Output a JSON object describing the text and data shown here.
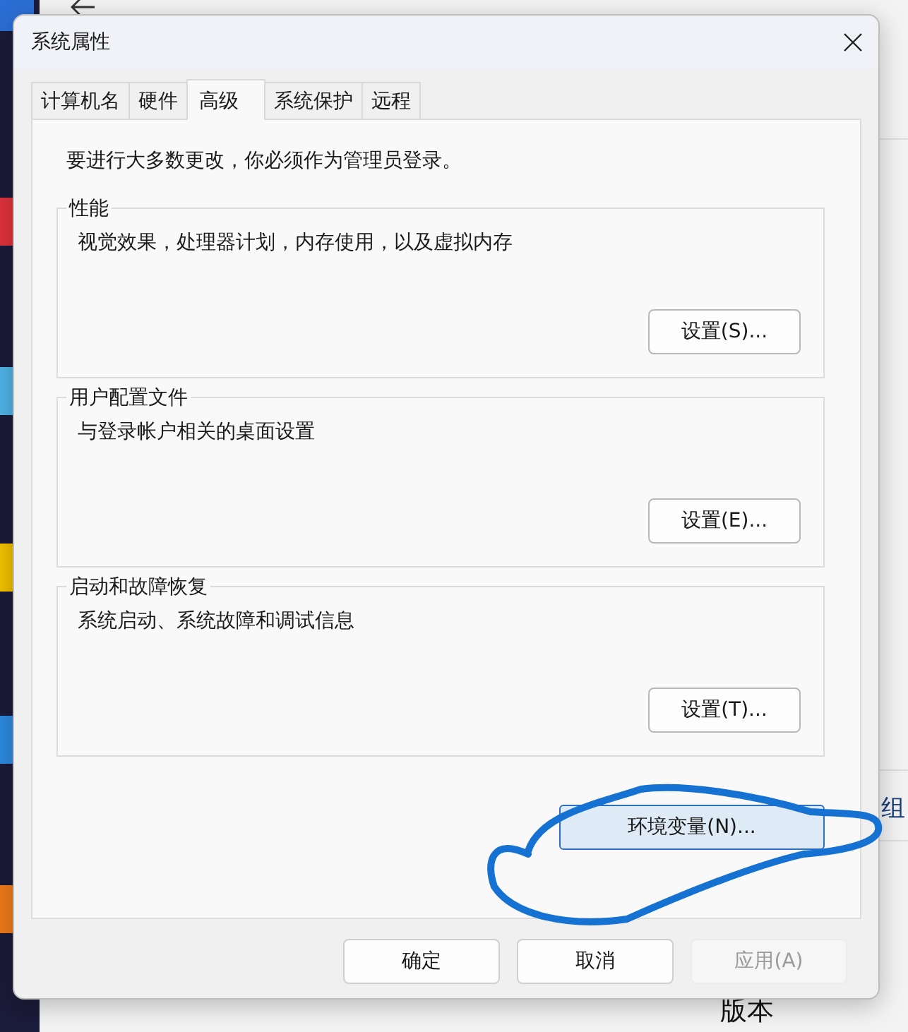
{
  "background": {
    "settings_window": {
      "link": "组",
      "section": "版本"
    }
  },
  "dialog": {
    "title": "系统属性",
    "tabs": [
      {
        "label": "计算机名",
        "selected": false
      },
      {
        "label": "硬件",
        "selected": false
      },
      {
        "label": "高级",
        "selected": true
      },
      {
        "label": "系统保护",
        "selected": false
      },
      {
        "label": "远程",
        "selected": false
      }
    ],
    "notice": "要进行大多数更改，你必须作为管理员登录。",
    "groups": [
      {
        "title": "性能",
        "description": "视觉效果，处理器计划，内存使用，以及虚拟内存",
        "button": "设置(S)..."
      },
      {
        "title": "用户配置文件",
        "description": "与登录帐户相关的桌面设置",
        "button": "设置(E)..."
      },
      {
        "title": "启动和故障恢复",
        "description": "系统启动、系统故障和调试信息",
        "button": "设置(T)..."
      }
    ],
    "env_button": {
      "label": "环境变量(N)...",
      "highlighted": true
    },
    "buttons": [
      {
        "label": "确定",
        "disabled": false
      },
      {
        "label": "取消",
        "disabled": false
      },
      {
        "label": "应用(A)",
        "disabled": true
      }
    ]
  }
}
